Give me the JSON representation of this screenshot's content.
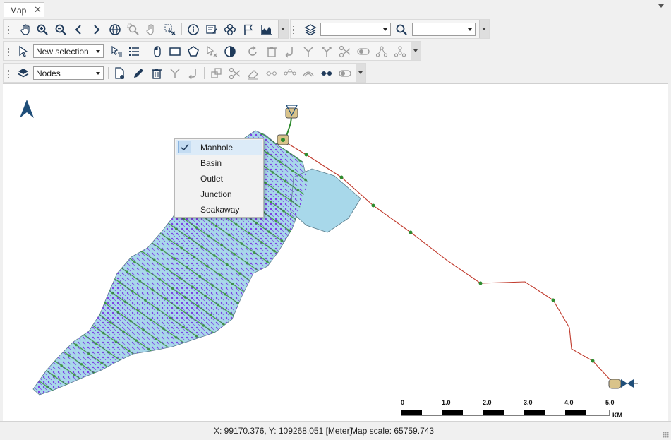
{
  "tab": {
    "title": "Map",
    "close_glyph": "✕"
  },
  "toolbar1": {
    "icons": [
      "hand-pan-icon",
      "zoom-in-icon",
      "zoom-out-icon",
      "previous-extent-icon",
      "next-extent-icon",
      "full-extent-globe-icon",
      "zoom-selected-icon",
      "pan-selected-icon",
      "clear-selection-icon",
      "info-icon",
      "edit-attributes-icon",
      "network-trace-icon",
      "flag-icon",
      "area-chart-icon"
    ],
    "layer_combo_value": "",
    "search_combo_value": ""
  },
  "toolbar2": {
    "selection_mode": "New selection",
    "icons": [
      "select-arrow-icon",
      "filter-selection-icon",
      "list-icon",
      "mouse-select-icon",
      "rectangle-select-icon",
      "polygon-select-icon",
      "clear-select-icon",
      "invert-selection-icon",
      "refresh-icon",
      "delete-icon",
      "undo-icon",
      "merge-icon",
      "split-icon",
      "scissors-icon",
      "toggle-icon",
      "network-icon",
      "connect-icon"
    ]
  },
  "toolbar3": {
    "layer": "Nodes",
    "icons": [
      "layers-icon",
      "new-feature-icon",
      "pencil-icon",
      "trash-icon",
      "branch-icon",
      "undo-icon",
      "transform-icon",
      "scissors-icon",
      "eraser-icon",
      "vertex-icon",
      "polygon-vertex-icon",
      "arc-icon",
      "node-pair-icon",
      "toggle-pill-icon"
    ]
  },
  "context_menu": {
    "items": [
      {
        "label": "Manhole",
        "checked": true
      },
      {
        "label": "Basin",
        "checked": false
      },
      {
        "label": "Outlet",
        "checked": false
      },
      {
        "label": "Junction",
        "checked": false
      },
      {
        "label": "Soakaway",
        "checked": false
      }
    ]
  },
  "map": {
    "scale_labels": [
      "0",
      "1.0",
      "2.0",
      "3.0",
      "4.0",
      "5.0"
    ],
    "scale_unit": "KM",
    "colors": {
      "catchment": "#a8d8ea",
      "pipe": "#2e8b2e",
      "node": "#7b3fe4",
      "trunk": "#c0392b",
      "north_arrow": "#1f4e79"
    }
  },
  "statusbar": {
    "coordinates": "X: 99170.376, Y: 109268.051 [Meter]",
    "map_scale": "Map scale: 65759.743"
  }
}
